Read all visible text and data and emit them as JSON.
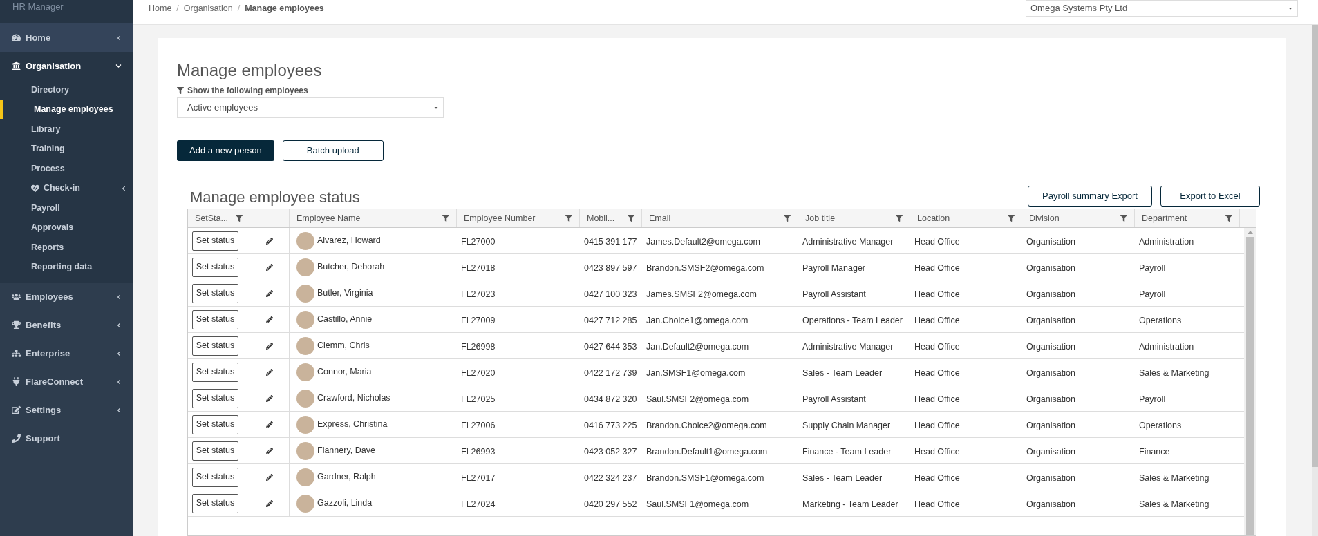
{
  "app_title": "HR Manager",
  "sidebar": {
    "items": [
      {
        "label": "Home",
        "expanded": false,
        "hovered": true
      },
      {
        "label": "Organisation",
        "expanded": true,
        "hovered": false,
        "children": [
          {
            "label": "Directory",
            "selected": false
          },
          {
            "label": "Manage employees",
            "selected": true
          },
          {
            "label": "Library",
            "selected": false
          },
          {
            "label": "Training",
            "selected": false
          },
          {
            "label": "Process",
            "selected": false
          },
          {
            "label": "Check-in",
            "selected": false,
            "expanded": false
          },
          {
            "label": "Payroll",
            "selected": false
          },
          {
            "label": "Approvals",
            "selected": false
          },
          {
            "label": "Reports",
            "selected": false
          },
          {
            "label": "Reporting data",
            "selected": false
          }
        ]
      },
      {
        "label": "Employees",
        "expanded": false,
        "hovered": false
      },
      {
        "label": "Benefits",
        "expanded": false,
        "hovered": false
      },
      {
        "label": "Enterprise",
        "expanded": false,
        "hovered": false
      },
      {
        "label": "FlareConnect",
        "expanded": false,
        "hovered": false
      },
      {
        "label": "Settings",
        "expanded": false,
        "hovered": false
      },
      {
        "label": "Support",
        "hovered": false
      }
    ]
  },
  "breadcrumb": [
    {
      "label": "Home"
    },
    {
      "separator": "/",
      "label": "Organisation"
    },
    {
      "separator": "/",
      "label": "Manage employees"
    }
  ],
  "company_select": {
    "value": "Omega Systems Pty Ltd"
  },
  "page_title": "Manage employees",
  "filter": {
    "label": "Show the following employees",
    "value": "Active employees"
  },
  "buttons": [
    {
      "label": "Add a new person",
      "kind": "primary"
    },
    {
      "label": "Batch upload",
      "kind": "outline"
    }
  ],
  "status_section": {
    "title": "Manage employee status",
    "buttons": [
      "Payroll summary Export",
      "Export to Excel"
    ]
  },
  "table": {
    "columns": [
      {
        "label": "SetSta...",
        "filter": true
      },
      {
        "filter": false
      },
      {
        "label": "Employee Name",
        "filter": true
      },
      {
        "label": "Employee Number",
        "filter": true
      },
      {
        "label": "Mobil...",
        "filter": true
      },
      {
        "label": "Email",
        "filter": true
      },
      {
        "label": "Job title",
        "filter": true
      },
      {
        "label": "Location",
        "filter": true
      },
      {
        "label": "Division",
        "filter": true
      },
      {
        "label": "Department",
        "filter": true
      }
    ],
    "rows": [
      {
        "action": "Set status",
        "name": "Alvarez, Howard",
        "number": "FL27000",
        "mobile": "0415 391 177",
        "email": "James.Default2@omega.com",
        "job": "Administrative Manager",
        "location": "Head Office",
        "division": "Organisation",
        "department": "Administration"
      },
      {
        "action": "Set status",
        "name": "Butcher, Deborah",
        "number": "FL27018",
        "mobile": "0423 897 597",
        "email": "Brandon.SMSF2@omega.com",
        "job": "Payroll Manager",
        "location": "Head Office",
        "division": "Organisation",
        "department": "Payroll"
      },
      {
        "action": "Set status",
        "name": "Butler, Virginia",
        "number": "FL27023",
        "mobile": "0427 100 323",
        "email": "James.SMSF2@omega.com",
        "job": "Payroll Assistant",
        "location": "Head Office",
        "division": "Organisation",
        "department": "Payroll"
      },
      {
        "action": "Set status",
        "name": "Castillo, Annie",
        "number": "FL27009",
        "mobile": "0427 712 285",
        "email": "Jan.Choice1@omega.com",
        "job": "Operations - Team Leader",
        "location": "Head Office",
        "division": "Organisation",
        "department": "Operations"
      },
      {
        "action": "Set status",
        "name": "Clemm, Chris",
        "number": "FL26998",
        "mobile": "0427 644 353",
        "email": "Jan.Default2@omega.com",
        "job": "Administrative Manager",
        "location": "Head Office",
        "division": "Organisation",
        "department": "Administration"
      },
      {
        "action": "Set status",
        "name": "Connor, Maria",
        "number": "FL27020",
        "mobile": "0422 172 739",
        "email": "Jan.SMSF1@omega.com",
        "job": "Sales - Team Leader",
        "location": "Head Office",
        "division": "Organisation",
        "department": "Sales & Marketing"
      },
      {
        "action": "Set status",
        "name": "Crawford, Nicholas",
        "number": "FL27025",
        "mobile": "0434 872 320",
        "email": "Saul.SMSF2@omega.com",
        "job": "Payroll Assistant",
        "location": "Head Office",
        "division": "Organisation",
        "department": "Payroll"
      },
      {
        "action": "Set status",
        "name": "Express, Christina",
        "number": "FL27006",
        "mobile": "0416 773 225",
        "email": "Brandon.Choice2@omega.com",
        "job": "Supply Chain Manager",
        "location": "Head Office",
        "division": "Organisation",
        "department": "Operations"
      },
      {
        "action": "Set status",
        "name": "Flannery, Dave",
        "number": "FL26993",
        "mobile": "0423 052 327",
        "email": "Brandon.Default1@omega.com",
        "job": "Finance - Team Leader",
        "location": "Head Office",
        "division": "Organisation",
        "department": "Finance"
      },
      {
        "action": "Set status",
        "name": "Gardner, Ralph",
        "number": "FL27017",
        "mobile": "0422 324 237",
        "email": "Brandon.SMSF1@omega.com",
        "job": "Sales - Team Leader",
        "location": "Head Office",
        "division": "Organisation",
        "department": "Sales & Marketing"
      },
      {
        "action": "Set status",
        "name": "Gazzoli, Linda",
        "number": "FL27024",
        "mobile": "0420 297 552",
        "email": "Saul.SMSF1@omega.com",
        "job": "Marketing - Team Leader",
        "location": "Head Office",
        "division": "Organisation",
        "department": "Sales & Marketing"
      }
    ]
  }
}
